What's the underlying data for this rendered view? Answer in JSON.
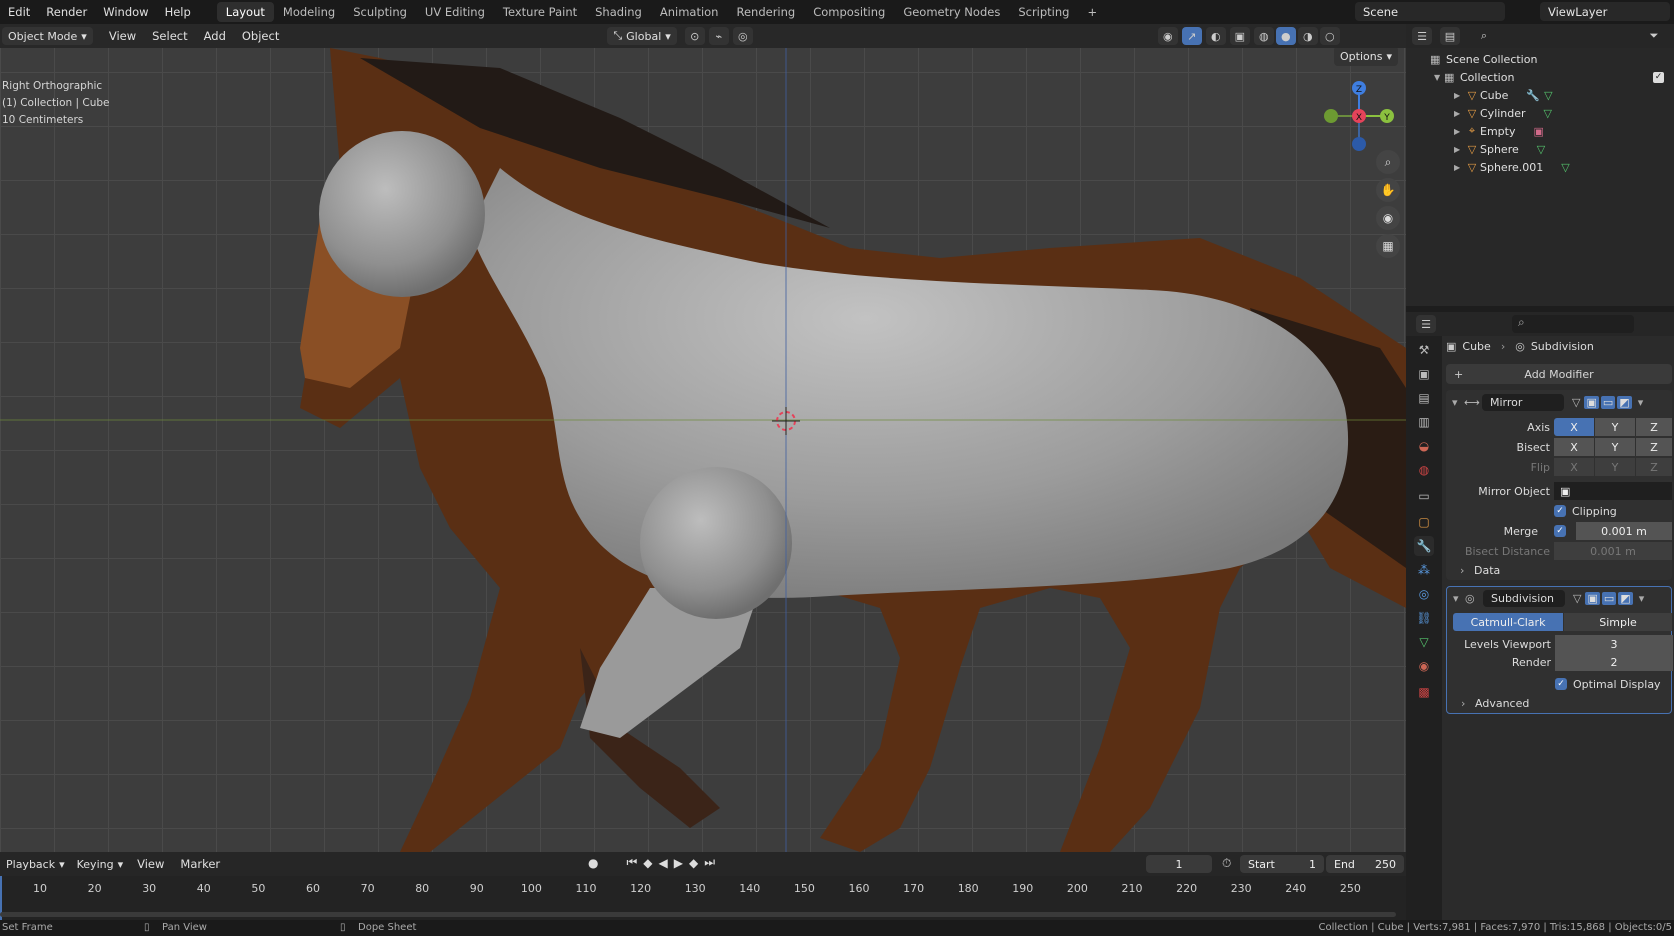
{
  "menu": {
    "items": [
      "Edit",
      "Render",
      "Window",
      "Help"
    ]
  },
  "workspace_tabs": [
    "Layout",
    "Modeling",
    "Sculpting",
    "UV Editing",
    "Texture Paint",
    "Shading",
    "Animation",
    "Rendering",
    "Compositing",
    "Geometry Nodes",
    "Scripting",
    "+"
  ],
  "scene": {
    "name": "Scene",
    "view_layer": "ViewLayer"
  },
  "viewport_header": {
    "mode": "Object Mode",
    "menus": [
      "View",
      "Select",
      "Add",
      "Object"
    ],
    "orientation": "Global"
  },
  "viewport": {
    "info_lines": [
      "Right Orthographic",
      "(1) Collection | Cube",
      "10 Centimeters"
    ],
    "options_label": "Options",
    "gizmo_axes": [
      "Z",
      "X",
      "Y"
    ]
  },
  "outliner": {
    "root": "Scene Collection",
    "collection": "Collection",
    "objects": [
      "Cube",
      "Cylinder",
      "Empty",
      "Sphere",
      "Sphere.001"
    ]
  },
  "properties": {
    "breadcrumb": [
      "Cube",
      "Subdivision"
    ],
    "add_modifier": "Add Modifier",
    "mirror": {
      "name": "Mirror",
      "axis_label": "Axis",
      "bisect_label": "Bisect",
      "flip_label": "Flip",
      "axes": [
        "X",
        "Y",
        "Z"
      ],
      "mirror_object_label": "Mirror Object",
      "clipping_label": "Clipping",
      "merge_label": "Merge",
      "merge_value": "0.001 m",
      "bisect_distance_label": "Bisect Distance",
      "bisect_distance_value": "0.001 m",
      "data_label": "Data"
    },
    "subdivision": {
      "name": "Subdivision",
      "catmull": "Catmull-Clark",
      "simple": "Simple",
      "levels_viewport_label": "Levels Viewport",
      "levels_viewport": "3",
      "render_label": "Render",
      "render_value": "2",
      "optimal_label": "Optimal Display",
      "advanced_label": "Advanced"
    }
  },
  "timeline": {
    "menus": [
      "Playback",
      "Keying",
      "View",
      "Marker"
    ],
    "current_frame": "1",
    "start_label": "Start",
    "start": "1",
    "end_label": "End",
    "end": "250",
    "ticks": [
      "10",
      "20",
      "30",
      "40",
      "50",
      "60",
      "70",
      "80",
      "90",
      "100",
      "110",
      "120",
      "130",
      "140",
      "150",
      "160",
      "170",
      "180",
      "190",
      "200",
      "210",
      "220",
      "230",
      "240",
      "250"
    ]
  },
  "status": {
    "left": "Set Frame",
    "pan": "Pan View",
    "dope": "Dope Sheet",
    "stats": "Collection | Cube | Verts:7,981 | Faces:7,970 | Tris:15,868 | Objects:0/5"
  },
  "colors": {
    "accent": "#4772b3",
    "axis_x": "#e5435a",
    "axis_y": "#8bc13f",
    "axis_z": "#3f7ee0"
  }
}
